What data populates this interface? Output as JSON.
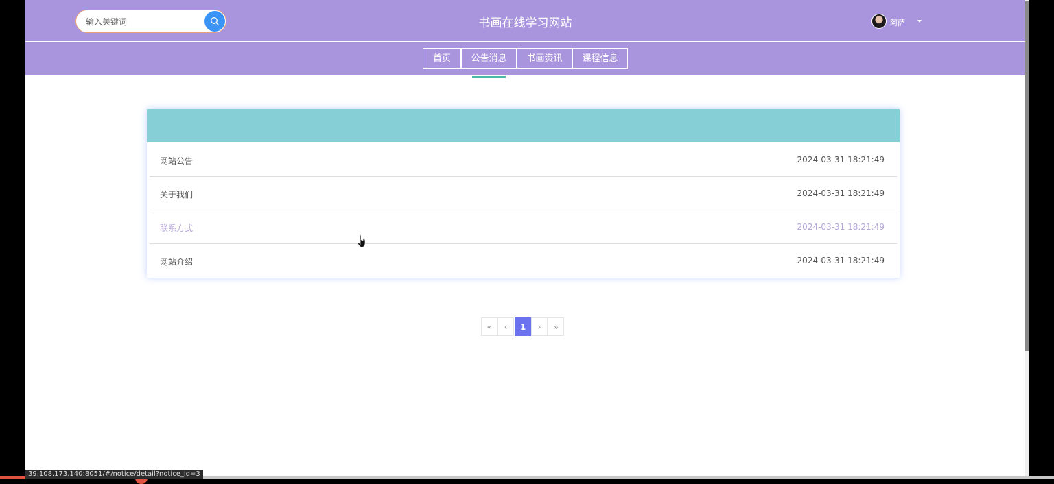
{
  "header": {
    "search_placeholder": "输入关键词",
    "site_title": "书画在线学习网站",
    "username": "阿萨"
  },
  "nav": {
    "items": [
      {
        "label": "首页"
      },
      {
        "label": "公告消息"
      },
      {
        "label": "书画资讯"
      },
      {
        "label": "课程信息"
      }
    ],
    "active": "公告消息"
  },
  "notices": [
    {
      "title": "网站公告",
      "date": "2024-03-31 18:21:49"
    },
    {
      "title": "关于我们",
      "date": "2024-03-31 18:21:49"
    },
    {
      "title": "联系方式",
      "date": "2024-03-31 18:21:49"
    },
    {
      "title": "网站介绍",
      "date": "2024-03-31 18:21:49"
    }
  ],
  "pagination": {
    "first": "«",
    "prev": "‹",
    "current": "1",
    "next": "›",
    "last": "»"
  },
  "status_bar": {
    "url": "39.108.173.140:8051/#/notice/detail?notice_id=3"
  },
  "colors": {
    "header_bg": "#a995dd",
    "card_header_bg": "#86cfd6",
    "active_underline": "#4ab7ad",
    "page_active": "#6a72f0",
    "search_button": "#3b93f6"
  }
}
